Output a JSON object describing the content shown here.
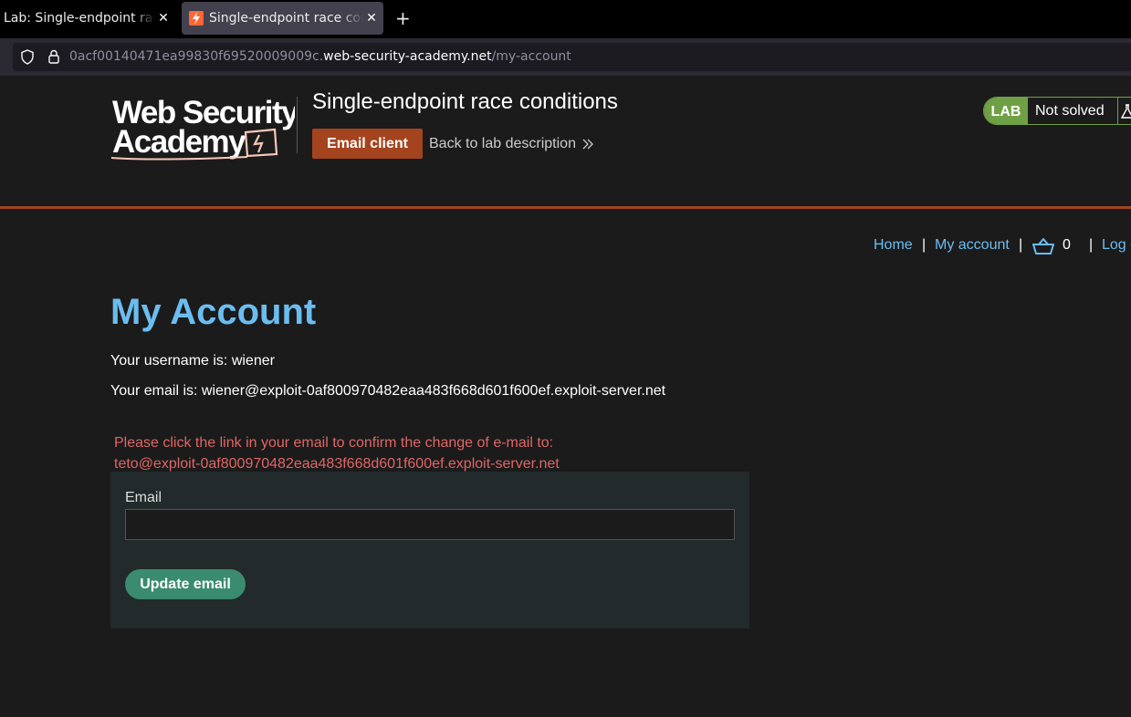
{
  "browser": {
    "tabs": [
      {
        "title": "Lab: Single-endpoint race conditions"
      },
      {
        "title": "Single-endpoint race conditions"
      }
    ],
    "close_glyph": "✕",
    "new_tab_glyph": "+",
    "url_prefix": "0acf00140471ea99830f69520009009c.",
    "url_host": "web-security-academy.net",
    "url_path": "/my-account"
  },
  "header": {
    "logo_line1": "Web Security",
    "logo_line2": "Academy",
    "lab_title": "Single-endpoint race conditions",
    "email_client_label": "Email client",
    "back_link_label": "Back to lab description",
    "status_tag": "LAB",
    "status_text": "Not solved",
    "accent_color": "#a4441e",
    "status_color": "#70a046"
  },
  "nav": {
    "home": "Home",
    "my_account": "My account",
    "separator": "|",
    "cart_count": "0",
    "logout": "Log out"
  },
  "content": {
    "heading": "My Account",
    "username_line": "Your username is: wiener",
    "email_line": "Your email is: wiener@exploit-0af800970482eaa483f668d601f600ef.exploit-server.net",
    "notice_line1": "Please click the link in your email to confirm the change of e-mail to:",
    "notice_line2": "teto@exploit-0af800970482eaa483f668d601f600ef.exploit-server.net",
    "form": {
      "email_label": "Email",
      "email_value": "",
      "submit_label": "Update email"
    }
  }
}
